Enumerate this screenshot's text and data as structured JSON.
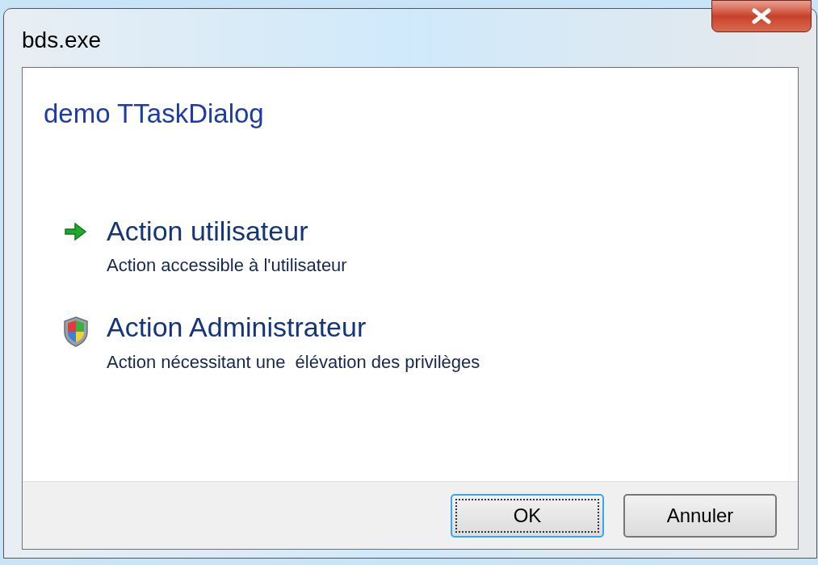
{
  "window": {
    "title": "bds.exe"
  },
  "main_instruction": "demo TTaskDialog",
  "command_links": [
    {
      "kind": "arrow",
      "title": "Action utilisateur",
      "description": "Action accessible à l'utilisateur"
    },
    {
      "kind": "shield",
      "title": "Action Administrateur",
      "description": "Action nécessitant une  élévation des privilèges"
    }
  ],
  "buttons": [
    {
      "label": "OK",
      "default": true
    },
    {
      "label": "Annuler",
      "default": false
    }
  ]
}
